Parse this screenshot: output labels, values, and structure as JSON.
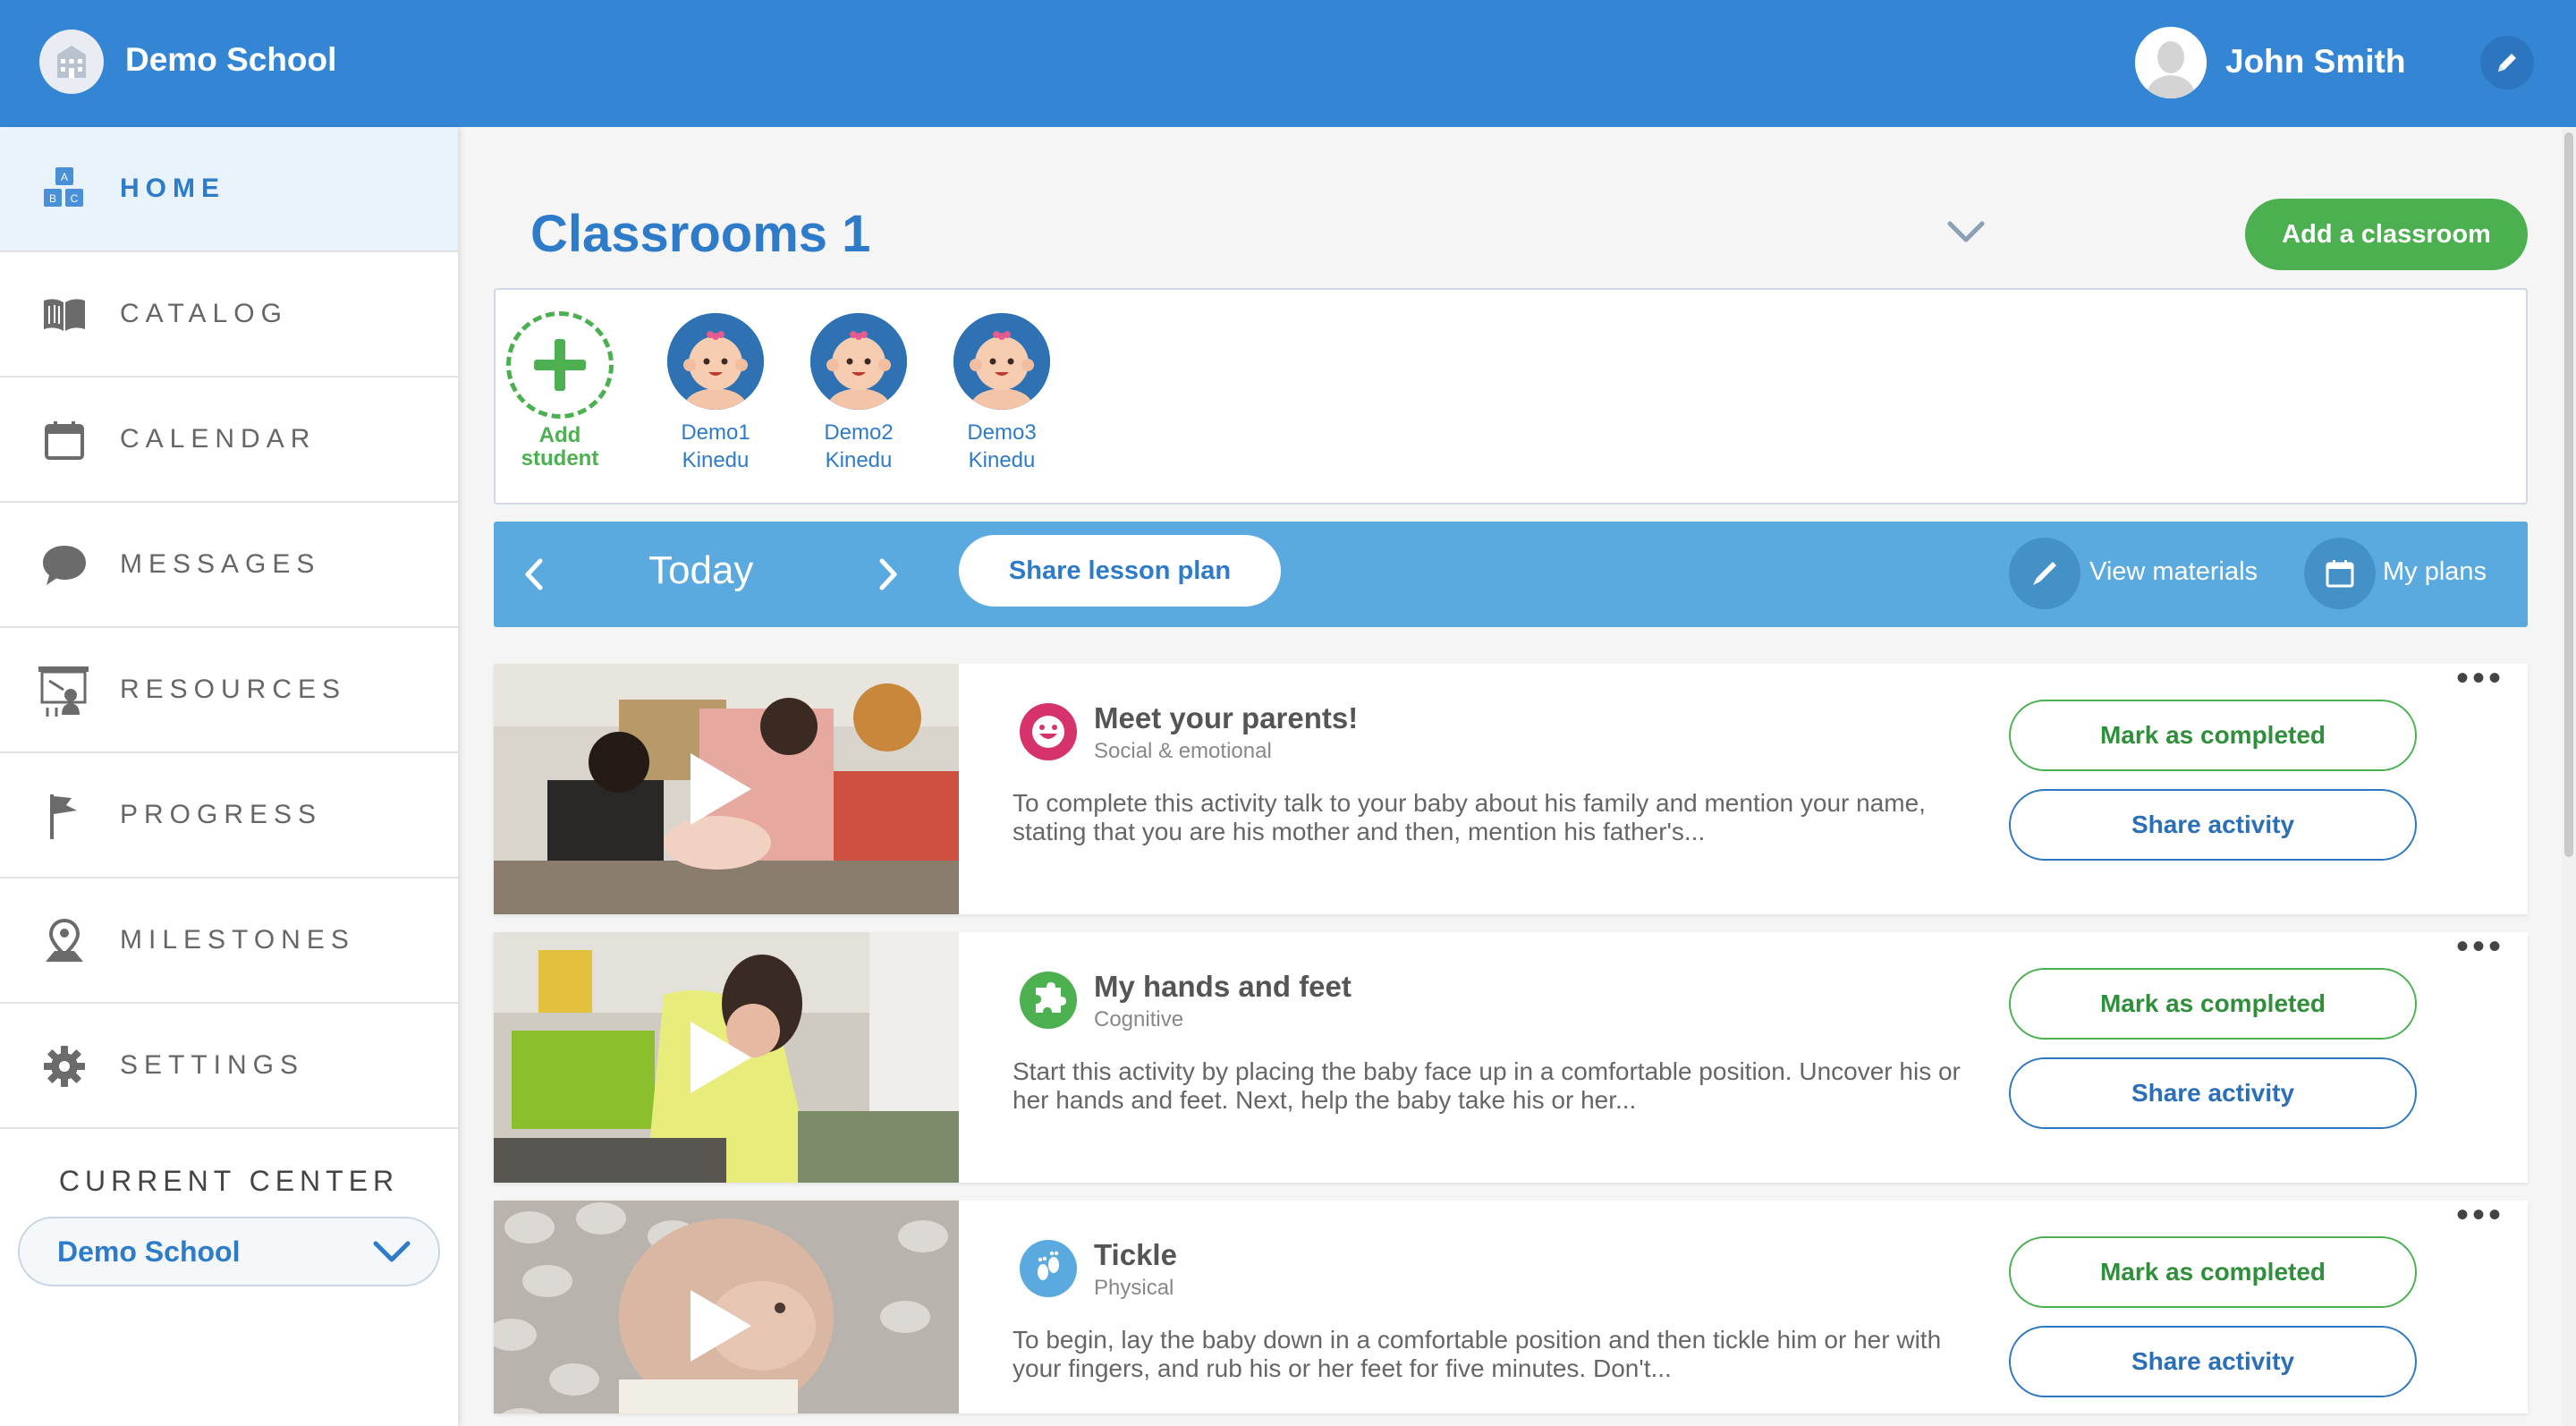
{
  "header": {
    "school_name": "Demo School",
    "user_name": "John Smith"
  },
  "sidebar": {
    "items": [
      {
        "label": "HOME",
        "icon": "abc-blocks-icon",
        "active": true
      },
      {
        "label": "CATALOG",
        "icon": "book-icon"
      },
      {
        "label": "CALENDAR",
        "icon": "calendar-icon"
      },
      {
        "label": "MESSAGES",
        "icon": "chat-bubble-icon"
      },
      {
        "label": "RESOURCES",
        "icon": "presentation-board-icon"
      },
      {
        "label": "PROGRESS",
        "icon": "flag-icon"
      },
      {
        "label": "MILESTONES",
        "icon": "map-pin-icon"
      },
      {
        "label": "SETTINGS",
        "icon": "gear-icon"
      }
    ],
    "current_center_title": "CURRENT CENTER",
    "current_center_value": "Demo School"
  },
  "classroom": {
    "title": "Classrooms 1",
    "add_button": "Add a classroom",
    "add_student_line1": "Add",
    "add_student_line2": "student",
    "students": [
      {
        "first": "Demo1",
        "last": "Kinedu"
      },
      {
        "first": "Demo2",
        "last": "Kinedu"
      },
      {
        "first": "Demo3",
        "last": "Kinedu"
      }
    ]
  },
  "daybar": {
    "day": "Today",
    "share_plan": "Share lesson plan",
    "view_materials": "View materials",
    "my_plans": "My plans"
  },
  "activities": [
    {
      "title": "Meet your parents!",
      "category": "Social & emotional",
      "category_icon": "smiley-icon",
      "category_color": "#d6336c",
      "description": "To complete this activity talk to your baby about his family and mention your name, stating that you are his mother and then, mention his father's...",
      "complete_label": "Mark as completed",
      "share_label": "Share activity"
    },
    {
      "title": "My hands and feet",
      "category": "Cognitive",
      "category_icon": "puzzle-icon",
      "category_color": "#4cb050",
      "description": "Start this activity by placing the baby face up in a comfortable position. Uncover his or her hands and feet. Next, help the baby take his or her...",
      "complete_label": "Mark as completed",
      "share_label": "Share activity"
    },
    {
      "title": "Tickle",
      "category": "Physical",
      "category_icon": "footprints-icon",
      "category_color": "#5aaae0",
      "description": "To begin, lay the baby down in a comfortable position and then tickle him or her with your fingers, and rub his or her feet for five minutes. Don't...",
      "complete_label": "Mark as completed",
      "share_label": "Share activity"
    }
  ],
  "colors": {
    "header_blue": "#3486d5",
    "accent_blue": "#2e7bc9",
    "daybar_blue": "#5aaae0",
    "green": "#4cb050"
  }
}
